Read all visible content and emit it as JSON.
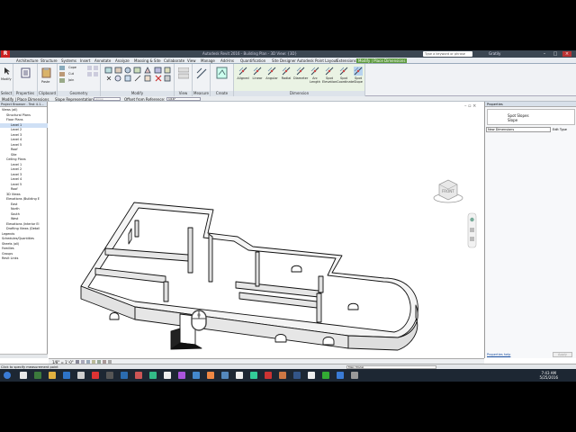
{
  "app": {
    "logo_letter": "R",
    "window_title": "Autodesk Revit 2016 - Building Plan - 3D View: {3D}",
    "search_placeholder": "Type a keyword or phrase",
    "user": "Gratily"
  },
  "tabs": [
    "Architecture",
    "Structure",
    "Systems",
    "Insert",
    "Annotate",
    "Analyze",
    "Massing & Site",
    "Collaborate",
    "View",
    "Manage",
    "Add-Ins",
    "Quantification",
    "Site Designer",
    "Autodesk Point Layout",
    "Extensions",
    "Modify | Place Dimensions"
  ],
  "active_tab": "Modify | Place Dimensions",
  "ribbon": {
    "select": {
      "label": "Select",
      "modify": "Modify"
    },
    "properties": {
      "label": "Properties"
    },
    "clipboard": {
      "label": "Clipboard",
      "paste": "Paste"
    },
    "geometry": {
      "label": "Geometry",
      "cope": "Cope",
      "cut": "Cut",
      "join": "Join"
    },
    "modify": {
      "label": "Modify"
    },
    "view": {
      "label": "View"
    },
    "measure": {
      "label": "Measure"
    },
    "create": {
      "label": "Create"
    },
    "dimension": {
      "label": "Dimension",
      "tools": [
        "Aligned",
        "Linear",
        "Angular",
        "Radial",
        "Diameter",
        "Arc Length",
        "Spot Elevation",
        "Spot Coordinate",
        "Spot Slope"
      ]
    }
  },
  "options_bar": {
    "context": "Modify | Place Dimensions",
    "slope_rep_label": "Slope Representation:",
    "slope_rep_value": "Arrow",
    "offset_label": "Offset from Reference:",
    "offset_value": "1/16\""
  },
  "project_browser": {
    "title": "Project Browser - Test 4.1...",
    "rows": [
      {
        "text": "Views (all)",
        "indent": 0
      },
      {
        "text": "Structural Plans",
        "indent": 1
      },
      {
        "text": "Floor Plans",
        "indent": 1
      },
      {
        "text": "Level 1",
        "indent": 2,
        "selected": true
      },
      {
        "text": "Level 2",
        "indent": 2
      },
      {
        "text": "Level 3",
        "indent": 2
      },
      {
        "text": "Level 4",
        "indent": 2
      },
      {
        "text": "Level 5",
        "indent": 2
      },
      {
        "text": "Roof",
        "indent": 2
      },
      {
        "text": "Site",
        "indent": 2
      },
      {
        "text": "Ceiling Plans",
        "indent": 1
      },
      {
        "text": "Level 1",
        "indent": 2
      },
      {
        "text": "Level 2",
        "indent": 2
      },
      {
        "text": "Level 3",
        "indent": 2
      },
      {
        "text": "Level 4",
        "indent": 2
      },
      {
        "text": "Level 5",
        "indent": 2
      },
      {
        "text": "Roof",
        "indent": 2
      },
      {
        "text": "3D Views",
        "indent": 1
      },
      {
        "text": "Elevations (Building E",
        "indent": 1
      },
      {
        "text": "East",
        "indent": 2
      },
      {
        "text": "North",
        "indent": 2
      },
      {
        "text": "South",
        "indent": 2
      },
      {
        "text": "West",
        "indent": 2
      },
      {
        "text": "Elevations (Interior El",
        "indent": 1
      },
      {
        "text": "Drafting Views (Detail",
        "indent": 1
      },
      {
        "text": "Legends",
        "indent": 0
      },
      {
        "text": "Schedules/Quantities",
        "indent": 0
      },
      {
        "text": "Sheets (all)",
        "indent": 0
      },
      {
        "text": "Families",
        "indent": 0
      },
      {
        "text": "Groups",
        "indent": 0
      },
      {
        "text": "Revit Links",
        "indent": 0
      }
    ]
  },
  "properties": {
    "title": "Properties",
    "type_line1": "Spot Slopes",
    "type_line2": "Slope",
    "selector": "New Dimensions",
    "edit_type": "Edit Type",
    "help_link": "Properties help",
    "apply": "Apply"
  },
  "viewcube": {
    "face": "FRONT"
  },
  "view_control": {
    "scale": "1/8\" = 1'-0\""
  },
  "status": {
    "message": "Click to specify measurement point",
    "model": "Main Model"
  },
  "taskbar": {
    "time": "7:43 AM",
    "date": "5/25/2016"
  },
  "colors": {
    "active_tab": "#5c9a3c",
    "titlebar": "#3b4652",
    "taskbar": "#1d2733",
    "wall_fill": "#e6e6e6",
    "wall_top": "#f4f4f4"
  }
}
